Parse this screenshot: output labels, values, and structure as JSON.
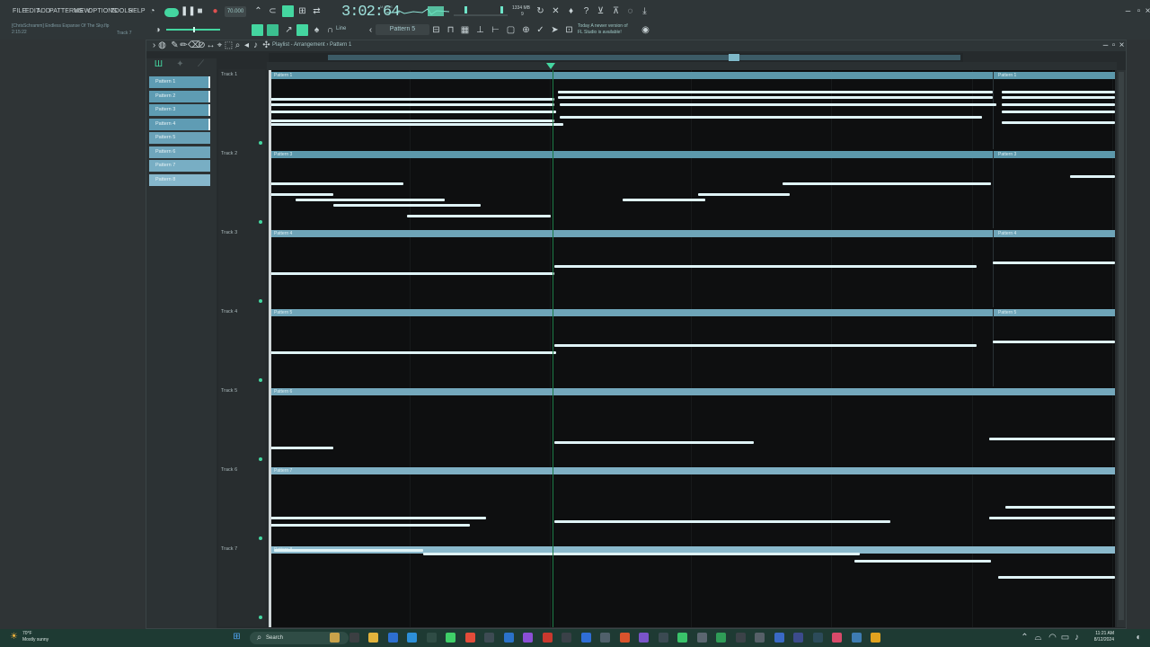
{
  "menu": [
    "FILE",
    "EDIT",
    "ADD",
    "PATTERNS",
    "VIEW",
    "OPTIONS",
    "TOOLS",
    "HELP"
  ],
  "song": {
    "title": "[ChrisSchramm] Endless Expanse Of The Sky.flp",
    "elapsed": "2:15:22",
    "hint": "Track 7"
  },
  "transport": {
    "tempo": "70.000",
    "time": "3:02:64",
    "cpu": "1334 MB",
    "cpu_sub": "9"
  },
  "toolbar": {
    "pattern": "Pattern 5",
    "snap": "Line",
    "news_line1": "Today  A newer version of",
    "news_line2": "FL Studio is available!"
  },
  "playlist": {
    "breadcrumb": "Playlist - Arrangement › Pattern 1"
  },
  "patterns": [
    "Pattern 1",
    "Pattern 2",
    "Pattern 3",
    "Pattern 4",
    "Pattern 5",
    "Pattern 6",
    "Pattern 7",
    "Pattern 8"
  ],
  "tracks": [
    {
      "label": "Track 1",
      "clips": [
        "Pattern 1",
        "Pattern 1"
      ]
    },
    {
      "label": "Track 2",
      "clips": [
        "Pattern 3",
        "Pattern 3"
      ]
    },
    {
      "label": "Track 3",
      "clips": [
        "Pattern 4",
        "Pattern 4"
      ]
    },
    {
      "label": "Track 4",
      "clips": [
        "Pattern 5",
        "Pattern 5"
      ]
    },
    {
      "label": "Track 5",
      "clips": [
        "Pattern 6"
      ]
    },
    {
      "label": "Track 6",
      "clips": [
        "Pattern 7"
      ]
    },
    {
      "label": "Track 7",
      "clips": [
        "Pattern 8"
      ]
    }
  ],
  "taskbar": {
    "temp": "70°F",
    "weather": "Mostly sunny",
    "search": "Search",
    "time": "11:21 AM",
    "date": "8/12/2024"
  },
  "colors": {
    "accent": "#44d6a0",
    "clip": "#5f9aad",
    "note": "#dff3f6",
    "playhead": "#1c7a45"
  }
}
